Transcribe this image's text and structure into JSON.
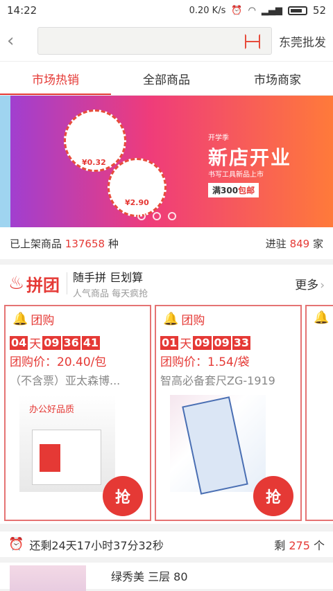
{
  "status": {
    "time": "14:22",
    "speed": "0.20 K/s",
    "battery": "52"
  },
  "header": {
    "city": "东莞批发"
  },
  "tabs": [
    "市场热销",
    "全部商品",
    "市场商家"
  ],
  "banner": {
    "subtitle": "开学季",
    "title": "新店开业",
    "caption": "书写工具新品上市",
    "promo_prefix": "满300",
    "promo_highlight": "包邮",
    "price_1": "¥0.32",
    "price_2": "¥2.90"
  },
  "stats": {
    "left_prefix": "已上架商品",
    "left_value": "137658",
    "left_suffix": "种",
    "right_prefix": "进驻",
    "right_value": "849",
    "right_suffix": "家"
  },
  "group_buy": {
    "logo": "拼团",
    "title": "随手拼 巨划算",
    "subtitle": "人气商品 每天疯抢",
    "more": "更多"
  },
  "cards": [
    {
      "label": "团购",
      "countdown": {
        "d": "04",
        "d_unit": "天",
        "h": "09",
        "m": "36",
        "s": "41"
      },
      "price": "团购价：20.40/包",
      "name": "（不含票）亚太森博...",
      "img_caption": "办公好品质",
      "button": "抢"
    },
    {
      "label": "团购",
      "countdown": {
        "d": "01",
        "d_unit": "天",
        "h": "09",
        "m": "09",
        "s": "33"
      },
      "price": "团购价：1.54/袋",
      "name": "智高必备套尺ZG-1919",
      "button": "抢"
    }
  ],
  "remain": {
    "text": "还剩24天17小时37分32秒",
    "count_prefix": "剩",
    "count_value": "275",
    "count_suffix": "个"
  },
  "next_item": {
    "title": "绿秀美 三层 80"
  }
}
